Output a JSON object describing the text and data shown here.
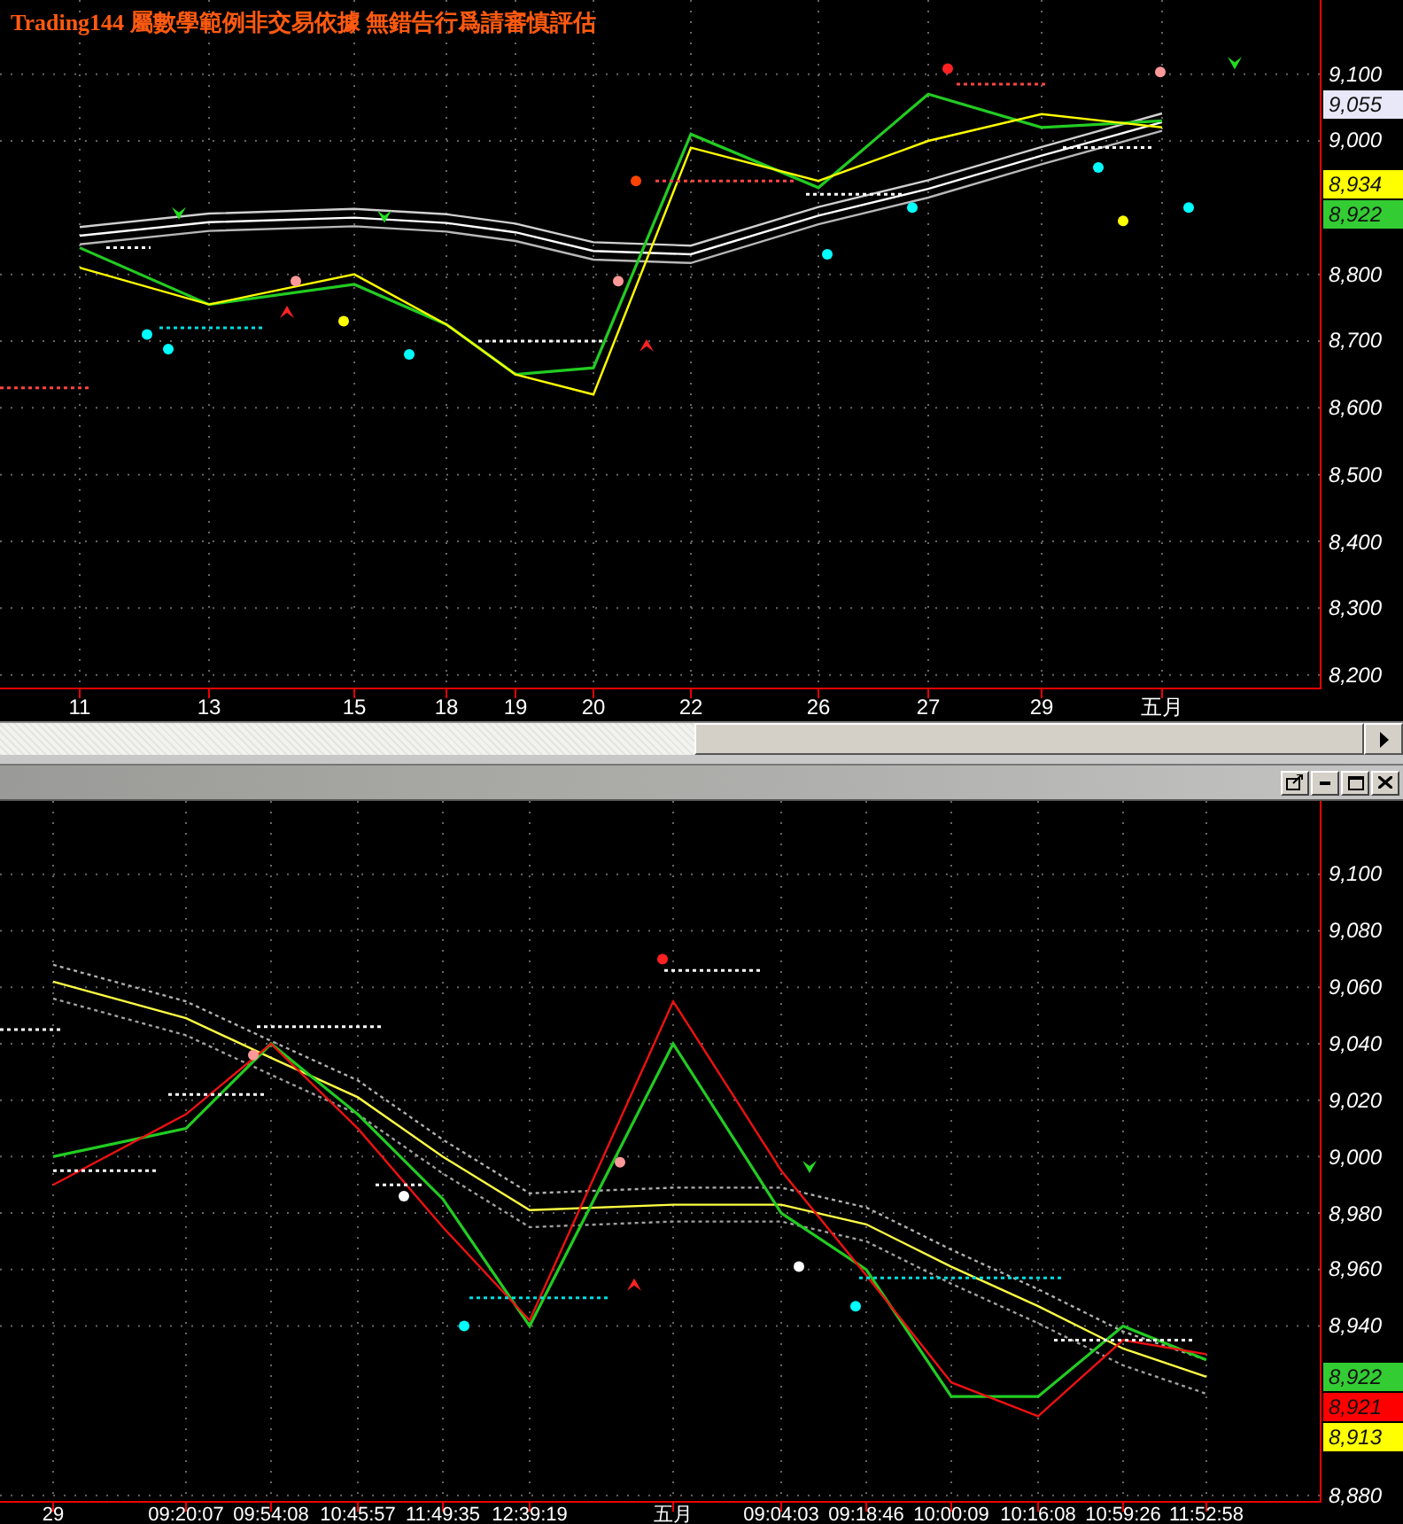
{
  "top_pane": {
    "title": "Trading144 屬數學範例非交易依據 無錯告行爲請審慎評估",
    "chart_data": {
      "type": "line",
      "grid": true,
      "categories": [
        "11",
        "13",
        "15",
        "18",
        "19",
        "20",
        "22",
        "26",
        "27",
        "29",
        "五月"
      ],
      "ylim": [
        8181,
        9211
      ],
      "yticks": [
        {
          "value": 8200,
          "label": "8,200"
        },
        {
          "value": 8300,
          "label": "8,300"
        },
        {
          "value": 8400,
          "label": "8,400"
        },
        {
          "value": 8500,
          "label": "8,500"
        },
        {
          "value": 8600,
          "label": "8,600"
        },
        {
          "value": 8700,
          "label": "8,700"
        },
        {
          "value": 8800,
          "label": "8,800"
        },
        {
          "value": 9000,
          "label": "9,000"
        },
        {
          "value": 9100,
          "label": "9,100"
        }
      ],
      "series": [
        {
          "color": "#d0d0d0",
          "values": [
            8871,
            8891,
            8898,
            8890,
            8876,
            8848,
            8843,
            8901,
            8941,
            8991,
            9041
          ]
        },
        {
          "color": "#ffffff",
          "values": [
            8858,
            8878,
            8885,
            8877,
            8863,
            8835,
            8830,
            8888,
            8928,
            8978,
            9028
          ]
        },
        {
          "color": "#b8b8b8",
          "values": [
            8845,
            8865,
            8872,
            8864,
            8850,
            8822,
            8817,
            8875,
            8915,
            8965,
            9015
          ]
        },
        {
          "color": "#22cc22",
          "values": [
            8840,
            8755,
            8785,
            8725,
            8650,
            8660,
            9010,
            8930,
            9070,
            9020,
            9030
          ]
        },
        {
          "color": "#ffff00",
          "values": [
            8810,
            8755,
            8800,
            8725,
            8650,
            8620,
            8990,
            8940,
            9000,
            9040,
            9020
          ]
        }
      ]
    },
    "price_tags": [
      {
        "label": "9,055",
        "color": "#e8e8f8"
      },
      {
        "label": "8,934",
        "color": "#ffff00"
      },
      {
        "label": "8,922",
        "color": "#33cc33"
      }
    ]
  },
  "scrollbar": {
    "level": 0.49
  },
  "bottom_pane": {
    "window_buttons": [
      {
        "kind": "popout"
      },
      {
        "kind": "minimize"
      },
      {
        "kind": "maximize"
      },
      {
        "kind": "close"
      }
    ],
    "chart_data": {
      "type": "line",
      "grid": true,
      "categories": [
        "29",
        "09:20:07",
        "09:54:08",
        "10:45:57",
        "11:49:35",
        "12:39:19",
        "五月",
        "09:04:03",
        "09:18:46",
        "10:00:09",
        "10:16:08",
        "10:59:26",
        "11:52:58"
      ],
      "ylim": [
        8878,
        9126
      ],
      "yticks": [
        {
          "value": 8880,
          "label": "8,880"
        },
        {
          "value": 8940,
          "label": "8,940"
        },
        {
          "value": 8960,
          "label": "8,960"
        },
        {
          "value": 8980,
          "label": "8,980"
        },
        {
          "value": 9000,
          "label": "9,000"
        },
        {
          "value": 9020,
          "label": "9,020"
        },
        {
          "value": 9040,
          "label": "9,040"
        },
        {
          "value": 9060,
          "label": "9,060"
        },
        {
          "value": 9080,
          "label": "9,080"
        },
        {
          "value": 9100,
          "label": "9,100"
        }
      ],
      "series": [
        {
          "color": "#b0b0b0",
          "line_style": "dashed",
          "values": [
            9068,
            9055,
            9041,
            9027,
            9006,
            8987,
            8989,
            8989,
            8982,
            8967,
            8953,
            8938,
            8928
          ]
        },
        {
          "color": "#ffff44",
          "values": [
            9062,
            9049,
            9035,
            9021,
            9000,
            8981,
            8983,
            8983,
            8976,
            8961,
            8947,
            8932,
            8922
          ]
        },
        {
          "color": "#a0a0a0",
          "line_style": "dashed",
          "values": [
            9056,
            9043,
            9029,
            9015,
            8994,
            8975,
            8977,
            8977,
            8970,
            8955,
            8941,
            8926,
            8916
          ]
        },
        {
          "color": "#22cc22",
          "values": [
            9000,
            9010,
            9040,
            9015,
            8985,
            8940,
            9040,
            8980,
            8960,
            8915,
            8915,
            8940,
            8928
          ]
        },
        {
          "color": "#ee1111",
          "values": [
            8990,
            9015,
            9040,
            9010,
            8975,
            8942,
            9055,
            8995,
            8958,
            8920,
            8908,
            8935,
            8930
          ]
        }
      ]
    },
    "price_tags": [
      {
        "label": "8,922",
        "color": "#33cc33"
      },
      {
        "label": "8,921",
        "color": "#ff0000"
      },
      {
        "label": "8,913",
        "color": "#ffff00"
      }
    ]
  }
}
